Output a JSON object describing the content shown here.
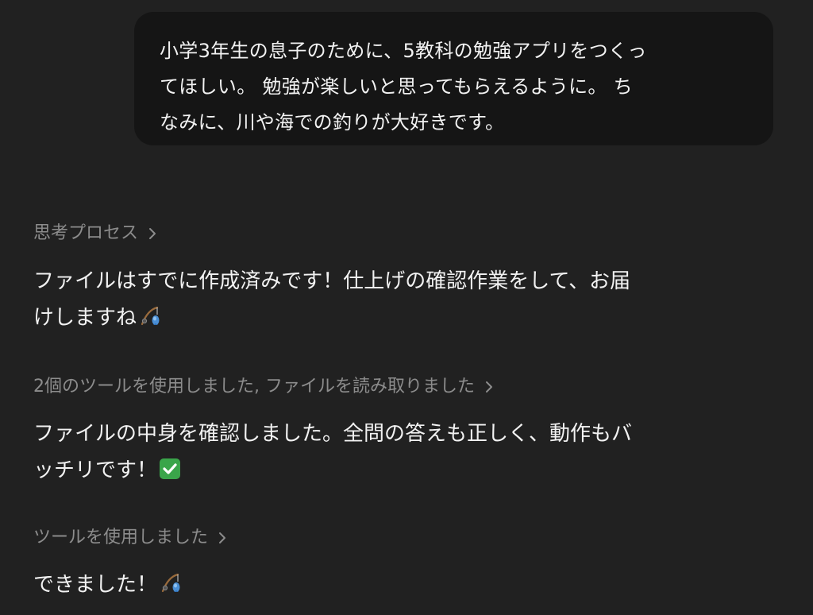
{
  "user_message": {
    "lines": [
      "小学3年生の息子のために、5教科の勉強アプリをつくっ",
      "てほしい。 勉強が楽しいと思ってもらえるように。 ち",
      "なみに、川や海での釣りが大好きです。"
    ]
  },
  "assistant": {
    "thinking_toggle": "思考プロセス",
    "reply1_lines": [
      "ファイルはすでに作成済みです！仕上げの確認作業をして、お届",
      "けしますね"
    ],
    "tools_toggle_1": "2個のツールを使用しました, ファイルを読み取りました",
    "reply2_lines": [
      "ファイルの中身を確認しました。全問の答えも正しく、動作もバ",
      "ッチリです！"
    ],
    "tools_toggle_2": "ツールを使用しました",
    "reply3": "できました！"
  },
  "icons": {
    "toggle_chevron": "chevron-right-icon",
    "fishing_emoji": "fishing-pole-icon",
    "check_emoji": "check-mark-button-icon"
  },
  "colors": {
    "background": "#212121",
    "user_bubble": "#151515",
    "text": "#f2f2f2",
    "muted": "#8c8c8c",
    "check_green": "#3aa54a"
  }
}
